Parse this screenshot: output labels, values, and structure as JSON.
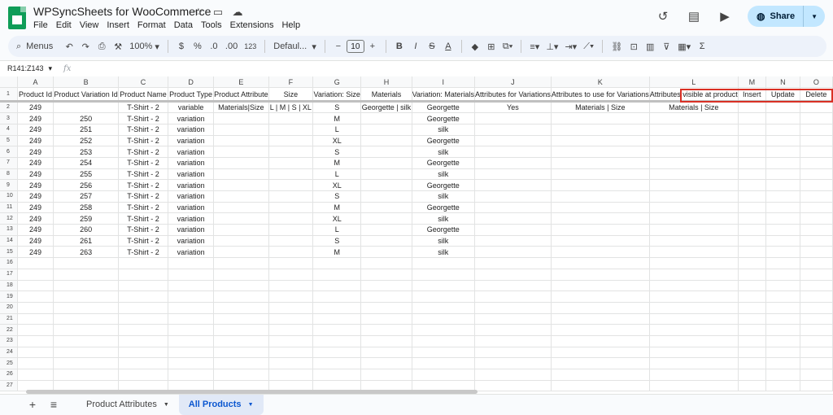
{
  "app": {
    "title": "WPSyncSheets for WooCommerce",
    "menus": [
      "File",
      "Edit",
      "View",
      "Insert",
      "Format",
      "Data",
      "Tools",
      "Extensions",
      "Help"
    ],
    "share_label": "Share"
  },
  "toolbar": {
    "menus_label": "Menus",
    "zoom": "100%",
    "currency": "$",
    "percent": "%",
    "dec_decrease": ".0",
    "dec_increase": ".00",
    "number_format": "123",
    "font": "Defaul...",
    "font_size": "10"
  },
  "formula": {
    "name_box": "R141:Z143",
    "fx": "fx"
  },
  "grid": {
    "columns": [
      "A",
      "B",
      "C",
      "D",
      "E",
      "F",
      "G",
      "H",
      "I",
      "J",
      "K",
      "L",
      "M",
      "N",
      "O"
    ],
    "header_row": [
      "Product Id",
      "Product Variation Id",
      "Product Name",
      "Product Type",
      "Product Attribute",
      "Size",
      "Variation: Size",
      "Materials",
      "Variation: Materials",
      "Attributes for Variations",
      "Attributes to use for Variations",
      "Attributes visible at product",
      "Insert",
      "Update",
      "Delete"
    ],
    "rows": [
      [
        "249",
        "",
        "T-Shirt - 2",
        "variable",
        "Materials|Size",
        "L | M | S | XL",
        "S",
        "Georgette | silk",
        "Georgette",
        "Yes",
        "Materials | Size",
        "Materials | Size",
        "",
        "",
        ""
      ],
      [
        "249",
        "250",
        "T-Shirt - 2",
        "variation",
        "",
        "",
        "M",
        "",
        "Georgette",
        "",
        "",
        "",
        "",
        "",
        ""
      ],
      [
        "249",
        "251",
        "T-Shirt - 2",
        "variation",
        "",
        "",
        "L",
        "",
        "silk",
        "",
        "",
        "",
        "",
        "",
        ""
      ],
      [
        "249",
        "252",
        "T-Shirt - 2",
        "variation",
        "",
        "",
        "XL",
        "",
        "Georgette",
        "",
        "",
        "",
        "",
        "",
        ""
      ],
      [
        "249",
        "253",
        "T-Shirt - 2",
        "variation",
        "",
        "",
        "S",
        "",
        "silk",
        "",
        "",
        "",
        "",
        "",
        ""
      ],
      [
        "249",
        "254",
        "T-Shirt - 2",
        "variation",
        "",
        "",
        "M",
        "",
        "Georgette",
        "",
        "",
        "",
        "",
        "",
        ""
      ],
      [
        "249",
        "255",
        "T-Shirt - 2",
        "variation",
        "",
        "",
        "L",
        "",
        "silk",
        "",
        "",
        "",
        "",
        "",
        ""
      ],
      [
        "249",
        "256",
        "T-Shirt - 2",
        "variation",
        "",
        "",
        "XL",
        "",
        "Georgette",
        "",
        "",
        "",
        "",
        "",
        ""
      ],
      [
        "249",
        "257",
        "T-Shirt - 2",
        "variation",
        "",
        "",
        "S",
        "",
        "silk",
        "",
        "",
        "",
        "",
        "",
        ""
      ],
      [
        "249",
        "258",
        "T-Shirt - 2",
        "variation",
        "",
        "",
        "M",
        "",
        "Georgette",
        "",
        "",
        "",
        "",
        "",
        ""
      ],
      [
        "249",
        "259",
        "T-Shirt - 2",
        "variation",
        "",
        "",
        "XL",
        "",
        "silk",
        "",
        "",
        "",
        "",
        "",
        ""
      ],
      [
        "249",
        "260",
        "T-Shirt - 2",
        "variation",
        "",
        "",
        "L",
        "",
        "Georgette",
        "",
        "",
        "",
        "",
        "",
        ""
      ],
      [
        "249",
        "261",
        "T-Shirt - 2",
        "variation",
        "",
        "",
        "S",
        "",
        "silk",
        "",
        "",
        "",
        "",
        "",
        ""
      ],
      [
        "249",
        "263",
        "T-Shirt - 2",
        "variation",
        "",
        "",
        "M",
        "",
        "silk",
        "",
        "",
        "",
        "",
        "",
        ""
      ]
    ],
    "row_numbers": [
      "1",
      "2",
      "3",
      "4",
      "5",
      "6",
      "7",
      "8",
      "9",
      "10",
      "11",
      "12",
      "13",
      "14",
      "15",
      "16",
      "17",
      "18",
      "19",
      "20",
      "21",
      "22",
      "23",
      "24",
      "25",
      "26",
      "27"
    ]
  },
  "sheets": {
    "tabs": [
      "Product Attributes",
      "All Products"
    ],
    "active": "All Products"
  },
  "colors": {
    "highlight_border": "#d93025",
    "share_bg": "#c2e7ff",
    "active_tab": "#0b57d0",
    "logo_green": "#0f9d58"
  }
}
